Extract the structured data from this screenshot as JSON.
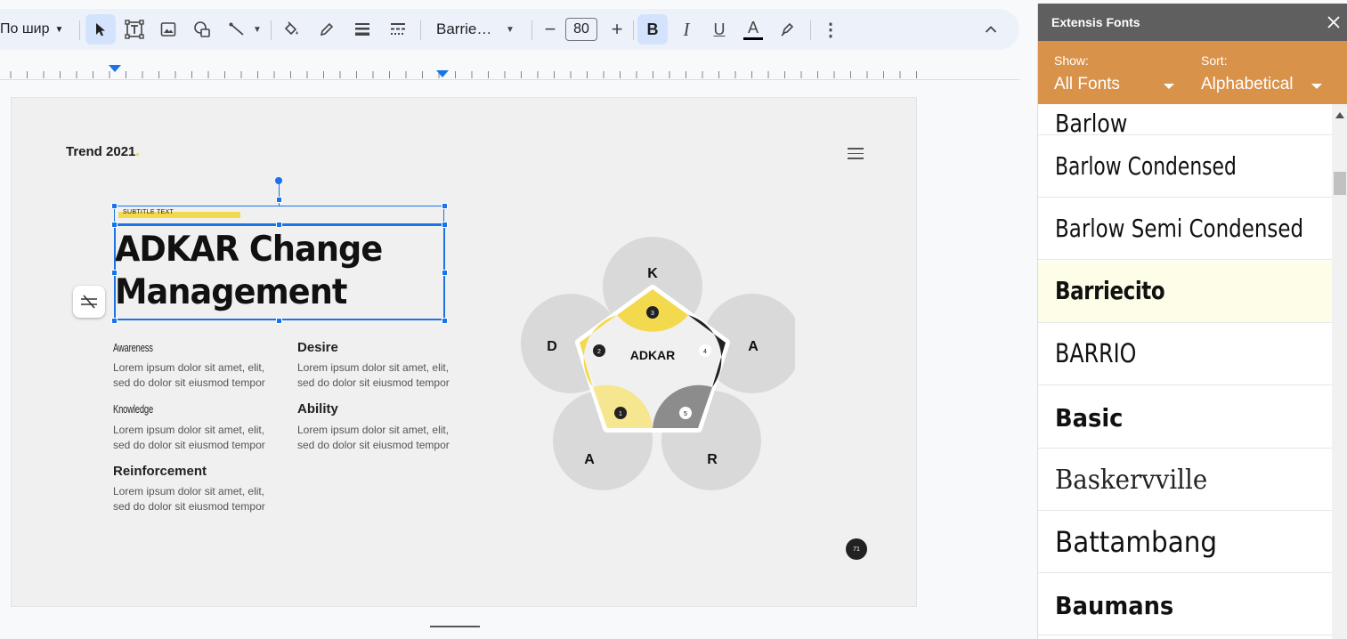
{
  "toolbar": {
    "paragraph_style": "По шир",
    "font_name": "Barrie…",
    "font_size": "80",
    "bold": "B",
    "italic": "I",
    "underline": "U",
    "text_color": "A"
  },
  "slide": {
    "brand": "Trend 2021",
    "subtitle": "SUBTITLE TEXT",
    "title_line1": "ADKAR Change",
    "title_line2": "Management",
    "items": [
      {
        "heading": "Awareness",
        "text": "Lorem ipsum dolor sit amet, elit, sed do dolor sit eiusmod tempor"
      },
      {
        "heading": "Desire",
        "text": "Lorem ipsum dolor sit amet, elit, sed do dolor sit eiusmod tempor"
      },
      {
        "heading": "Knowledge",
        "text": "Lorem ipsum dolor sit amet, elit, sed do dolor sit eiusmod tempor"
      },
      {
        "heading": "Ability",
        "text": "Lorem ipsum dolor sit amet, elit, sed do dolor sit eiusmod tempor"
      },
      {
        "heading": "Reinforcement",
        "text": "Lorem ipsum dolor sit amet, elit, sed do dolor sit eiusmod tempor"
      }
    ],
    "diagram": {
      "center": "ADKAR",
      "letters": [
        "K",
        "A",
        "R",
        "A",
        "D"
      ],
      "numbers": [
        "1",
        "2",
        "3",
        "4",
        "5"
      ]
    },
    "page_number": "71"
  },
  "panel": {
    "title": "Extensis Fonts",
    "show_label": "Show:",
    "show_value": "All Fonts",
    "sort_label": "Sort:",
    "sort_value": "Alphabetical",
    "fonts": [
      "Barlow",
      "Barlow Condensed",
      "Barlow Semi Condensed",
      "Barriecito",
      "BARRIO",
      "Basic",
      "Baskervville",
      "Battambang",
      "Baumans"
    ]
  },
  "colors": {
    "accent_yellow": "#f2d94e",
    "panel_header": "#5f5f5f",
    "panel_bar": "#d9924a",
    "selected_font_bg": "#fdfde8",
    "selection_blue": "#1a73e8"
  }
}
